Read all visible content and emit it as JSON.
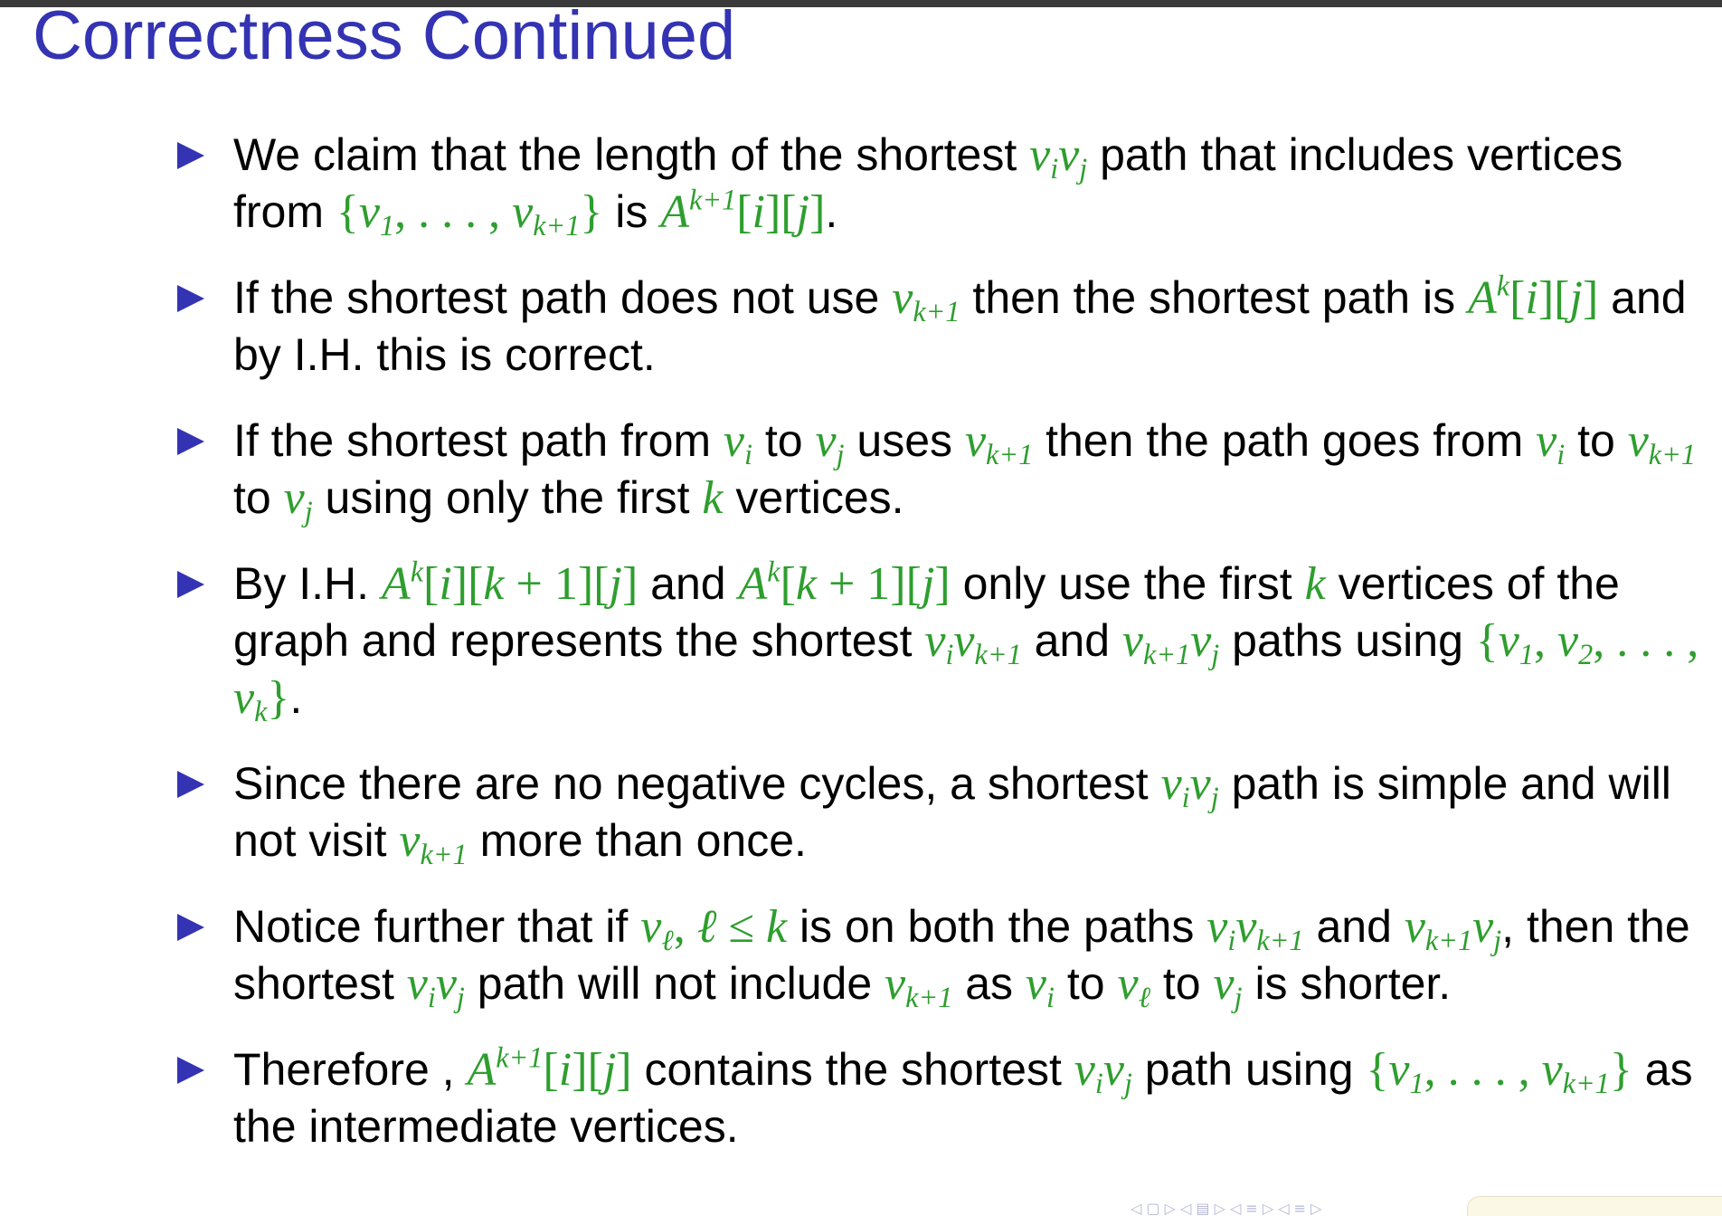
{
  "slide": {
    "title": "Correctness Continued"
  },
  "bullets": [
    {
      "parts": [
        {
          "t": "text",
          "v": "We claim that the length of the shortest "
        },
        {
          "t": "math",
          "v": "v<sub>i</sub>v<sub>j</sub>"
        },
        {
          "t": "text",
          "v": " path that includes vertices from "
        },
        {
          "t": "math",
          "v": "<span class=\"up\">{</span>v<sub>1</sub><span class=\"up\">, . . . , </span>v<sub>k+1</sub><span class=\"up\">}</span>"
        },
        {
          "t": "text",
          "v": " is "
        },
        {
          "t": "math",
          "v": "A<sup>k+1</sup><span class=\"up\">[</span>i<span class=\"up\">][</span>j<span class=\"up\">]</span>"
        },
        {
          "t": "text",
          "v": "."
        }
      ]
    },
    {
      "parts": [
        {
          "t": "text",
          "v": "If the shortest path does not use "
        },
        {
          "t": "math",
          "v": "v<sub>k+1</sub>"
        },
        {
          "t": "text",
          "v": " then the shortest path is "
        },
        {
          "t": "math",
          "v": "A<sup>k</sup><span class=\"up\">[</span>i<span class=\"up\">][</span>j<span class=\"up\">]</span>"
        },
        {
          "t": "text",
          "v": " and by I.H. this is correct."
        }
      ]
    },
    {
      "parts": [
        {
          "t": "text",
          "v": "If the shortest path from "
        },
        {
          "t": "math",
          "v": "v<sub>i</sub>"
        },
        {
          "t": "text",
          "v": " to "
        },
        {
          "t": "math",
          "v": "v<sub>j</sub>"
        },
        {
          "t": "text",
          "v": " uses "
        },
        {
          "t": "math",
          "v": "v<sub>k+1</sub>"
        },
        {
          "t": "text",
          "v": " then the path goes from "
        },
        {
          "t": "math",
          "v": "v<sub>i</sub>"
        },
        {
          "t": "text",
          "v": " to "
        },
        {
          "t": "math",
          "v": "v<sub>k+1</sub>"
        },
        {
          "t": "text",
          "v": " to "
        },
        {
          "t": "math",
          "v": "v<sub>j</sub>"
        },
        {
          "t": "text",
          "v": " using only the first "
        },
        {
          "t": "math",
          "v": "k"
        },
        {
          "t": "text",
          "v": " vertices."
        }
      ]
    },
    {
      "parts": [
        {
          "t": "text",
          "v": "By I.H. "
        },
        {
          "t": "math",
          "v": "A<sup>k</sup><span class=\"up\">[</span>i<span class=\"up\">][</span>k <span class=\"up\">+ 1][</span>j<span class=\"up\">]</span>"
        },
        {
          "t": "text",
          "v": " and "
        },
        {
          "t": "math",
          "v": "A<sup>k</sup><span class=\"up\">[</span>k <span class=\"up\">+ 1][</span>j<span class=\"up\">]</span>"
        },
        {
          "t": "text",
          "v": " only use the first "
        },
        {
          "t": "math",
          "v": "k"
        },
        {
          "t": "text",
          "v": " vertices of the graph and represents the shortest "
        },
        {
          "t": "math",
          "v": "v<sub>i</sub>v<sub>k+1</sub>"
        },
        {
          "t": "text",
          "v": " and "
        },
        {
          "t": "math",
          "v": "v<sub>k+1</sub>v<sub>j</sub>"
        },
        {
          "t": "text",
          "v": " paths using "
        },
        {
          "t": "math",
          "v": "<span class=\"up\">{</span>v<sub>1</sub><span class=\"up\">, </span>v<sub>2</sub><span class=\"up\">, . . . , </span>v<sub>k</sub><span class=\"up\">}</span>"
        },
        {
          "t": "text",
          "v": "."
        }
      ]
    },
    {
      "parts": [
        {
          "t": "text",
          "v": "Since there are no negative cycles, a shortest "
        },
        {
          "t": "math",
          "v": "v<sub>i</sub>v<sub>j</sub>"
        },
        {
          "t": "text",
          "v": " path is simple and will not visit "
        },
        {
          "t": "math",
          "v": "v<sub>k+1</sub>"
        },
        {
          "t": "text",
          "v": " more than once."
        }
      ]
    },
    {
      "parts": [
        {
          "t": "text",
          "v": "Notice further that if "
        },
        {
          "t": "math",
          "v": "v<sub>ℓ</sub><span class=\"up\">, </span>ℓ <span class=\"up\">≤</span> k"
        },
        {
          "t": "text",
          "v": " is on both the paths "
        },
        {
          "t": "math",
          "v": "v<sub>i</sub>v<sub>k+1</sub>"
        },
        {
          "t": "text",
          "v": " and "
        },
        {
          "t": "math",
          "v": "v<sub>k+1</sub>v<sub>j</sub>"
        },
        {
          "t": "text",
          "v": ", then the shortest "
        },
        {
          "t": "math",
          "v": "v<sub>i</sub>v<sub>j</sub>"
        },
        {
          "t": "text",
          "v": " path will not include "
        },
        {
          "t": "math",
          "v": "v<sub>k+1</sub>"
        },
        {
          "t": "text",
          "v": " as "
        },
        {
          "t": "math",
          "v": "v<sub>i</sub>"
        },
        {
          "t": "text",
          "v": " to "
        },
        {
          "t": "math",
          "v": "v<sub>ℓ</sub>"
        },
        {
          "t": "text",
          "v": " to "
        },
        {
          "t": "math",
          "v": "v<sub>j</sub>"
        },
        {
          "t": "text",
          "v": " is shorter."
        }
      ]
    },
    {
      "parts": [
        {
          "t": "text",
          "v": "Therefore , "
        },
        {
          "t": "math",
          "v": "A<sup>k+1</sup><span class=\"up\">[</span>i<span class=\"up\">][</span>j<span class=\"up\">]</span>"
        },
        {
          "t": "text",
          "v": " contains the shortest "
        },
        {
          "t": "math",
          "v": "v<sub>i</sub>v<sub>j</sub>"
        },
        {
          "t": "text",
          "v": " path using "
        },
        {
          "t": "math",
          "v": "<span class=\"up\">{</span>v<sub>1</sub><span class=\"up\">, . . . , </span>v<sub>k+1</sub><span class=\"up\">}</span>"
        },
        {
          "t": "text",
          "v": " as the intermediate vertices."
        }
      ]
    }
  ],
  "navigation": {
    "symbols": "◁ ▢ ▷ ◁ ▤ ▷ ◁ ≡ ▷ ◁ ≡ ▷"
  },
  "colors": {
    "title": "#3333b3",
    "bullet_marker": "#3333b3",
    "math": "#2e9e2e",
    "text": "#000000"
  }
}
